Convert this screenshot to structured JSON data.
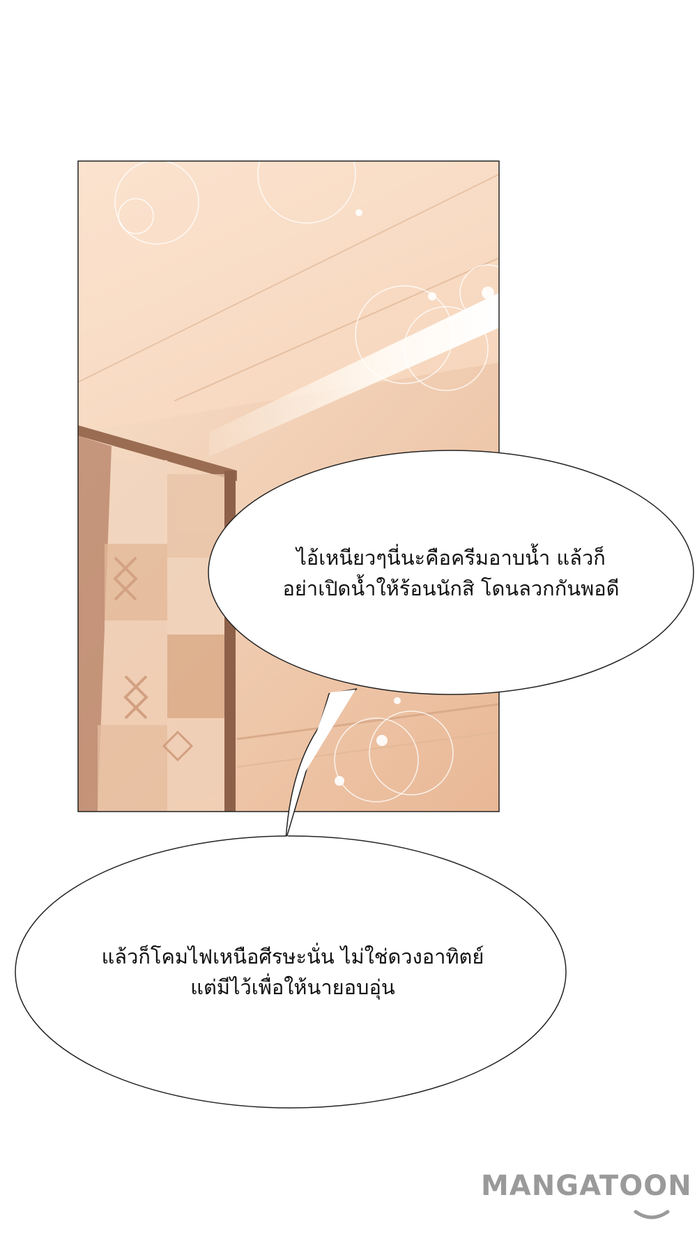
{
  "bubbles": [
    {
      "lines": [
        "ไอ้เหนียวๆนี่นะคือครีมอาบน้ำ แล้วก็",
        "อย่าเปิดน้ำให้ร้อนนักสิ โดนลวกกันพอดี"
      ]
    },
    {
      "lines": [
        "แล้วก็โคมไฟเหนือศีรษะนั่น ไม่ใช่ดวงอาทิตย์",
        "แต่มีไว้เพื่อให้นายอบอุ่น"
      ]
    }
  ],
  "watermark": {
    "text": "MANGATOON"
  },
  "colors": {
    "panel_warm": "#f6d2b6",
    "panel_light": "#fbe8d6",
    "watermark": "#9a9a9a"
  }
}
